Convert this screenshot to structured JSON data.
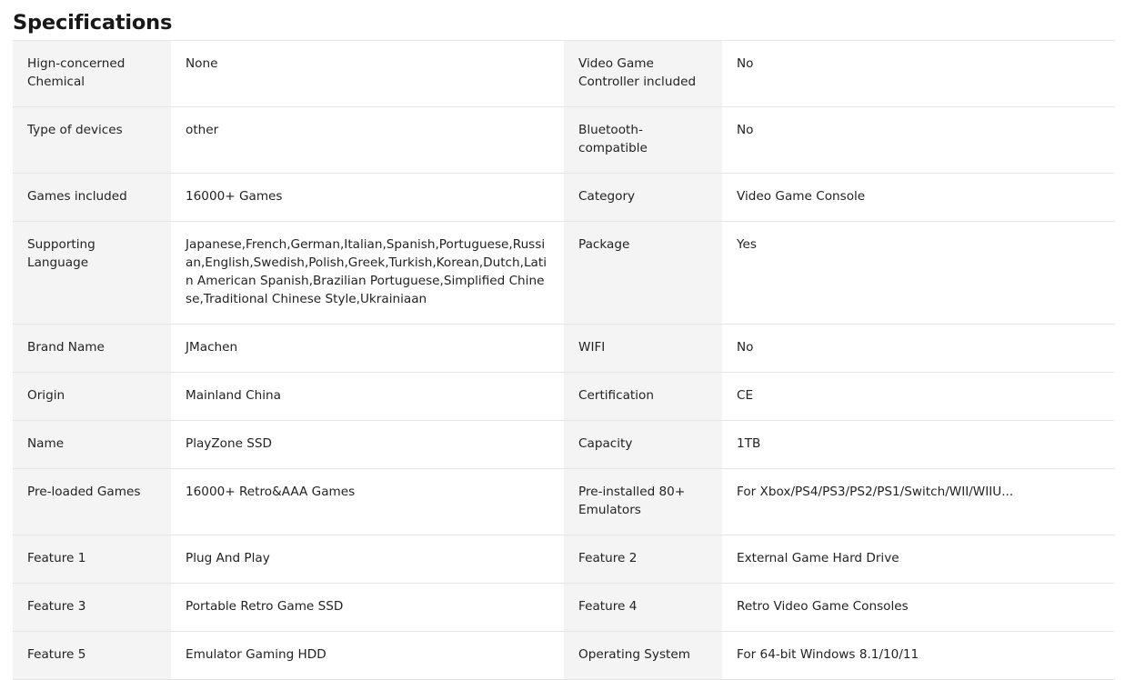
{
  "section": {
    "title": "Specifications"
  },
  "rows": [
    {
      "k1": "Hign-concerned Chemical",
      "v1": "None",
      "k2": "Video Game Controller included",
      "v2": "No"
    },
    {
      "k1": "Type of devices",
      "v1": "other",
      "k2": "Bluetooth-compatible",
      "v2": "No"
    },
    {
      "k1": "Games included",
      "v1": "16000+ Games",
      "k2": "Category",
      "v2": "Video Game Console"
    },
    {
      "k1": "Supporting Language",
      "v1": "Japanese,French,German,Italian,Spanish,Portuguese,Russian,English,Swedish,Polish,Greek,Turkish,Korean,Dutch,Latin American Spanish,Brazilian Portuguese,Simplified Chinese,Traditional Chinese Style,Ukrainiaan",
      "k2": "Package",
      "v2": "Yes"
    },
    {
      "k1": "Brand Name",
      "v1": "JMachen",
      "k2": "WIFI",
      "v2": "No"
    },
    {
      "k1": "Origin",
      "v1": "Mainland China",
      "k2": "Certification",
      "v2": "CE"
    },
    {
      "k1": "Name",
      "v1": "PlayZone SSD",
      "k2": "Capacity",
      "v2": "1TB"
    },
    {
      "k1": "Pre-loaded Games",
      "v1": "16000+ Retro&AAA Games",
      "k2": "Pre-installed 80+ Emulators",
      "v2": "For Xbox/PS4/PS3/PS2/PS1/Switch/WII/WIIU..."
    },
    {
      "k1": "Feature 1",
      "v1": "Plug And Play",
      "k2": "Feature 2",
      "v2": "External Game Hard Drive"
    },
    {
      "k1": "Feature 3",
      "v1": "Portable Retro Game SSD",
      "k2": "Feature 4",
      "v2": "Retro Video Game Consoles"
    },
    {
      "k1": "Feature 5",
      "v1": "Emulator Gaming HDD",
      "k2": "Operating System",
      "v2": "For 64-bit Windows 8.1/10/11"
    }
  ]
}
